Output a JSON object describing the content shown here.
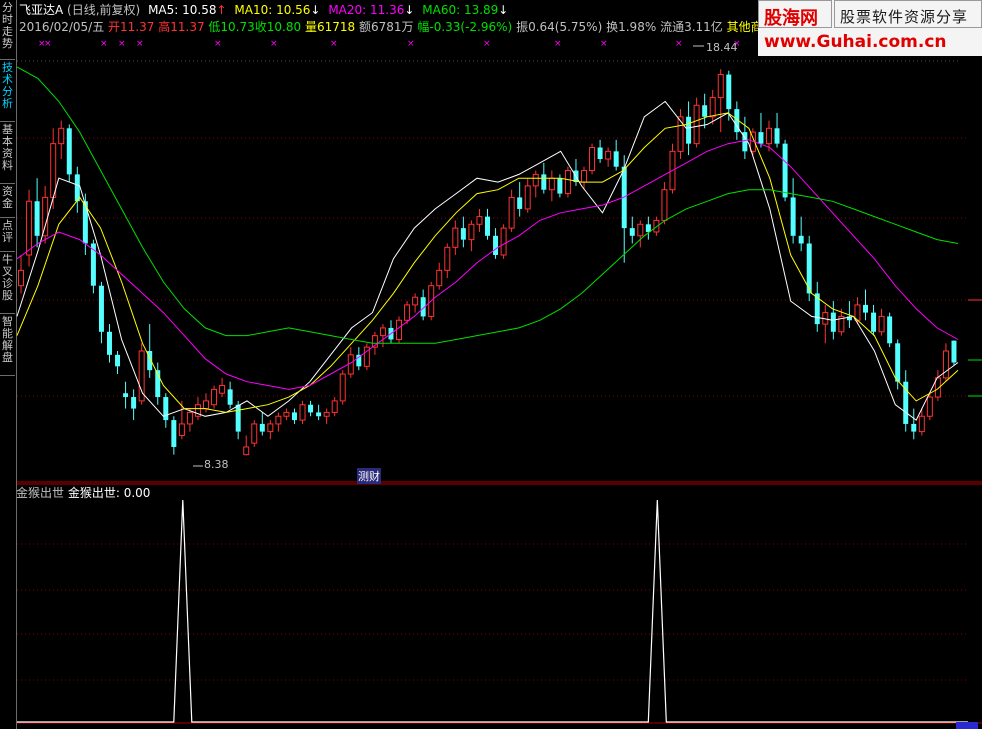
{
  "sidebar": {
    "tabs": [
      {
        "label": "分时走势",
        "active": false
      },
      {
        "label": "技术分析",
        "active": true
      },
      {
        "label": "基本资料",
        "active": false
      },
      {
        "label": "资金",
        "active": false
      },
      {
        "label": "点评",
        "active": false
      },
      {
        "label": "牛叉诊股",
        "active": false
      },
      {
        "label": "智能解盘",
        "active": false
      }
    ]
  },
  "header": {
    "stock_name": "飞亚达A",
    "period": "(日线,前复权)",
    "ma5": "MA5: 10.58",
    "ma10": "MA10: 10.56",
    "ma20": "MA20: 11.36",
    "ma60": "MA60: 13.89",
    "date": "2016/02/05/五",
    "open": "开11.37",
    "high": "高11.37",
    "low": "低10.73",
    "close": "收10.80",
    "volume": "量61718",
    "amount": "额6781万",
    "change": "幅-0.33(-2.96%)",
    "amplitude": "振0.64(5.75%)",
    "turnover": "换1.98%",
    "float_cap": "流通3.11亿",
    "sector": "其他商业"
  },
  "annotations": {
    "high_label": "18.44",
    "low_label": "8.38",
    "marker": "测财"
  },
  "indicator": {
    "title": "金猴出世",
    "value": "金猴出世: 0.00"
  },
  "watermark": {
    "site_name": "股海网",
    "slogan": "股票软件资源分享",
    "url": "www.Guhai.com.cn"
  },
  "colors": {
    "up": "#ff3232",
    "down": "#54ffff",
    "ma5": "#ffffff",
    "ma10": "#ffff00",
    "ma20": "#ff00ff",
    "ma60": "#00e000"
  },
  "chart_data": [
    {
      "type": "candlestick",
      "title": "飞亚达A",
      "ylim": [
        8.0,
        19.2
      ],
      "high_price": 18.44,
      "low_price": 8.38,
      "ohlc": [
        [
          12.8,
          13.6,
          12.6,
          13.2
        ],
        [
          13.6,
          15.3,
          13.3,
          15.0
        ],
        [
          15.0,
          15.6,
          13.8,
          14.1
        ],
        [
          14.1,
          15.4,
          13.9,
          15.1
        ],
        [
          15.1,
          16.9,
          14.8,
          16.5
        ],
        [
          16.5,
          17.1,
          16.1,
          16.9
        ],
        [
          16.9,
          17.0,
          15.5,
          15.7
        ],
        [
          15.7,
          15.9,
          14.7,
          15.0
        ],
        [
          15.0,
          15.2,
          13.6,
          13.9
        ],
        [
          13.9,
          14.0,
          12.6,
          12.8
        ],
        [
          12.8,
          12.9,
          11.3,
          11.6
        ],
        [
          11.6,
          11.8,
          10.8,
          11.0
        ],
        [
          11.0,
          11.1,
          10.5,
          10.7
        ],
        [
          10.0,
          10.3,
          9.6,
          9.9
        ],
        [
          9.9,
          10.1,
          9.3,
          9.6
        ],
        [
          9.8,
          11.3,
          9.7,
          11.1
        ],
        [
          11.1,
          11.8,
          10.4,
          10.6
        ],
        [
          10.6,
          10.8,
          9.7,
          9.9
        ],
        [
          9.9,
          10.0,
          9.1,
          9.3
        ],
        [
          9.3,
          9.4,
          8.4,
          8.6
        ],
        [
          8.9,
          9.8,
          8.8,
          9.2
        ],
        [
          9.2,
          9.6,
          9.0,
          9.5
        ],
        [
          9.4,
          9.9,
          9.3,
          9.7
        ],
        [
          9.6,
          10.0,
          9.5,
          9.8
        ],
        [
          9.7,
          10.2,
          9.6,
          10.1
        ],
        [
          10.0,
          10.4,
          9.9,
          10.2
        ],
        [
          10.1,
          10.3,
          9.6,
          9.7
        ],
        [
          9.7,
          9.8,
          8.8,
          9.0
        ],
        [
          8.4,
          8.9,
          8.38,
          8.6
        ],
        [
          8.7,
          9.3,
          8.6,
          9.2
        ],
        [
          9.2,
          9.5,
          8.9,
          9.0
        ],
        [
          9.0,
          9.3,
          8.8,
          9.2
        ],
        [
          9.2,
          9.5,
          9.0,
          9.4
        ],
        [
          9.4,
          9.6,
          9.3,
          9.5
        ],
        [
          9.5,
          9.6,
          9.2,
          9.3
        ],
        [
          9.3,
          9.8,
          9.2,
          9.7
        ],
        [
          9.7,
          9.8,
          9.4,
          9.5
        ],
        [
          9.5,
          9.7,
          9.3,
          9.4
        ],
        [
          9.4,
          9.6,
          9.2,
          9.5
        ],
        [
          9.5,
          9.9,
          9.4,
          9.8
        ],
        [
          9.8,
          10.6,
          9.7,
          10.5
        ],
        [
          10.5,
          11.2,
          10.4,
          11.0
        ],
        [
          11.0,
          11.2,
          10.6,
          10.7
        ],
        [
          10.7,
          11.3,
          10.6,
          11.2
        ],
        [
          11.2,
          11.6,
          11.0,
          11.5
        ],
        [
          11.5,
          11.8,
          11.2,
          11.7
        ],
        [
          11.7,
          11.9,
          11.3,
          11.4
        ],
        [
          11.4,
          12.0,
          11.3,
          11.9
        ],
        [
          11.9,
          12.4,
          11.8,
          12.3
        ],
        [
          12.3,
          12.6,
          12.1,
          12.5
        ],
        [
          12.5,
          12.7,
          11.9,
          12.0
        ],
        [
          12.0,
          12.9,
          11.9,
          12.8
        ],
        [
          12.8,
          13.4,
          12.7,
          13.2
        ],
        [
          13.2,
          13.9,
          13.0,
          13.8
        ],
        [
          13.8,
          14.5,
          13.6,
          14.3
        ],
        [
          14.3,
          14.6,
          13.8,
          14.0
        ],
        [
          14.0,
          14.5,
          13.7,
          14.4
        ],
        [
          14.4,
          14.8,
          14.2,
          14.6
        ],
        [
          14.6,
          14.8,
          14.0,
          14.1
        ],
        [
          14.1,
          14.3,
          13.5,
          13.6
        ],
        [
          13.6,
          14.4,
          13.5,
          14.3
        ],
        [
          14.3,
          15.3,
          14.2,
          15.1
        ],
        [
          15.1,
          15.5,
          14.6,
          14.8
        ],
        [
          14.8,
          15.6,
          14.7,
          15.4
        ],
        [
          15.4,
          15.8,
          15.1,
          15.7
        ],
        [
          15.7,
          16.0,
          15.2,
          15.3
        ],
        [
          15.3,
          15.8,
          15.0,
          15.6
        ],
        [
          15.6,
          15.7,
          15.1,
          15.2
        ],
        [
          15.2,
          15.9,
          15.1,
          15.8
        ],
        [
          15.8,
          16.1,
          15.4,
          15.5
        ],
        [
          15.5,
          15.9,
          15.3,
          15.8
        ],
        [
          15.8,
          16.5,
          15.7,
          16.4
        ],
        [
          16.4,
          16.6,
          16.0,
          16.1
        ],
        [
          16.1,
          16.4,
          15.9,
          16.3
        ],
        [
          16.3,
          16.6,
          15.8,
          15.9
        ],
        [
          15.9,
          16.2,
          13.4,
          14.3
        ],
        [
          14.3,
          14.6,
          13.9,
          14.1
        ],
        [
          14.1,
          14.5,
          13.8,
          14.4
        ],
        [
          14.4,
          14.6,
          14.0,
          14.2
        ],
        [
          14.2,
          14.6,
          14.1,
          14.5
        ],
        [
          14.5,
          15.5,
          14.4,
          15.3
        ],
        [
          15.3,
          16.5,
          15.2,
          16.3
        ],
        [
          16.3,
          17.4,
          16.1,
          17.2
        ],
        [
          17.2,
          17.6,
          16.2,
          16.5
        ],
        [
          16.5,
          17.7,
          16.4,
          17.5
        ],
        [
          17.5,
          17.8,
          16.9,
          17.2
        ],
        [
          17.2,
          17.9,
          17.0,
          17.7
        ],
        [
          17.7,
          18.44,
          16.8,
          18.3
        ],
        [
          18.3,
          18.4,
          17.1,
          17.4
        ],
        [
          17.4,
          17.6,
          16.6,
          16.8
        ],
        [
          16.8,
          17.2,
          16.1,
          16.3
        ],
        [
          16.3,
          16.9,
          16.2,
          16.8
        ],
        [
          16.8,
          17.3,
          16.4,
          16.5
        ],
        [
          16.5,
          17.1,
          16.3,
          16.9
        ],
        [
          16.9,
          17.3,
          16.4,
          16.5
        ],
        [
          16.5,
          16.6,
          15.0,
          15.1
        ],
        [
          15.1,
          15.6,
          13.9,
          14.1
        ],
        [
          14.1,
          14.6,
          13.7,
          13.9
        ],
        [
          13.9,
          14.1,
          12.4,
          12.6
        ],
        [
          12.6,
          12.9,
          11.6,
          11.8
        ],
        [
          11.8,
          12.3,
          11.3,
          12.1
        ],
        [
          12.1,
          12.4,
          11.4,
          11.6
        ],
        [
          11.6,
          12.2,
          11.5,
          12.0
        ],
        [
          12.0,
          12.4,
          11.7,
          11.9
        ],
        [
          11.9,
          12.5,
          11.8,
          12.3
        ],
        [
          12.3,
          12.7,
          11.9,
          12.1
        ],
        [
          12.1,
          12.3,
          11.5,
          11.6
        ],
        [
          11.6,
          12.2,
          11.5,
          12.0
        ],
        [
          12.0,
          12.1,
          11.2,
          11.3
        ],
        [
          11.3,
          11.4,
          10.1,
          10.3
        ],
        [
          10.3,
          10.6,
          9.0,
          9.2
        ],
        [
          9.2,
          9.6,
          8.8,
          9.0
        ],
        [
          9.0,
          9.6,
          8.9,
          9.4
        ],
        [
          9.4,
          10.0,
          9.3,
          9.9
        ],
        [
          9.9,
          10.6,
          9.8,
          10.4
        ],
        [
          10.4,
          11.3,
          10.3,
          11.1
        ],
        [
          11.37,
          11.37,
          10.73,
          10.8
        ]
      ],
      "ma_lines": [
        {
          "name": "MA5",
          "values": [
            12.0,
            13.7,
            15.6,
            15.4,
            13.6,
            11.4,
            10.0,
            9.4,
            9.6,
            9.4,
            9.5,
            9.8,
            9.4,
            9.8,
            10.3,
            11.0,
            11.7,
            12.1,
            13.5,
            14.3,
            14.8,
            15.2,
            15.6,
            15.5,
            15.7,
            16.0,
            16.3,
            15.4,
            14.7,
            15.8,
            17.2,
            17.6,
            16.9,
            17.0,
            17.3,
            16.5,
            14.8,
            12.4,
            12.0,
            11.9,
            12.0,
            11.1,
            9.7,
            9.3,
            10.4,
            10.8
          ]
        },
        {
          "name": "MA10",
          "values": [
            11.5,
            12.8,
            14.4,
            15.1,
            14.3,
            12.9,
            11.3,
            10.2,
            9.6,
            9.6,
            9.5,
            9.6,
            9.7,
            9.9,
            10.2,
            10.7,
            11.3,
            11.9,
            12.6,
            13.4,
            14.1,
            14.7,
            15.2,
            15.3,
            15.6,
            15.6,
            15.6,
            15.5,
            15.5,
            15.8,
            16.4,
            16.9,
            17.0,
            17.2,
            17.3,
            16.9,
            15.6,
            13.6,
            12.6,
            12.2,
            12.0,
            11.5,
            10.4,
            9.8,
            10.1,
            10.6
          ]
        },
        {
          "name": "MA20",
          "values": [
            13.5,
            13.9,
            14.2,
            14.0,
            13.6,
            13.1,
            12.6,
            12.1,
            11.5,
            10.9,
            10.5,
            10.3,
            10.2,
            10.1,
            10.2,
            10.5,
            10.8,
            11.2,
            11.6,
            12.0,
            12.5,
            12.9,
            13.4,
            13.8,
            14.1,
            14.5,
            14.7,
            14.8,
            14.9,
            15.1,
            15.4,
            15.7,
            16.0,
            16.3,
            16.5,
            16.6,
            16.4,
            15.9,
            15.3,
            14.7,
            14.1,
            13.5,
            12.8,
            12.2,
            11.7,
            11.4
          ]
        },
        {
          "name": "MA60",
          "values": [
            18.5,
            18.2,
            17.6,
            16.8,
            15.8,
            14.8,
            13.8,
            12.9,
            12.2,
            11.7,
            11.5,
            11.5,
            11.6,
            11.7,
            11.6,
            11.5,
            11.4,
            11.3,
            11.3,
            11.3,
            11.3,
            11.4,
            11.5,
            11.6,
            11.7,
            11.9,
            12.2,
            12.6,
            13.1,
            13.6,
            14.1,
            14.5,
            14.8,
            15.0,
            15.2,
            15.3,
            15.3,
            15.2,
            15.1,
            15.0,
            14.8,
            14.6,
            14.4,
            14.2,
            14.0,
            13.9
          ]
        }
      ]
    },
    {
      "type": "line",
      "title": "金猴出世",
      "ylim": [
        0,
        1
      ],
      "spikes": [
        [
          18,
          1
        ],
        [
          77,
          1
        ]
      ],
      "values_note": "0 except two signal spikes"
    }
  ]
}
